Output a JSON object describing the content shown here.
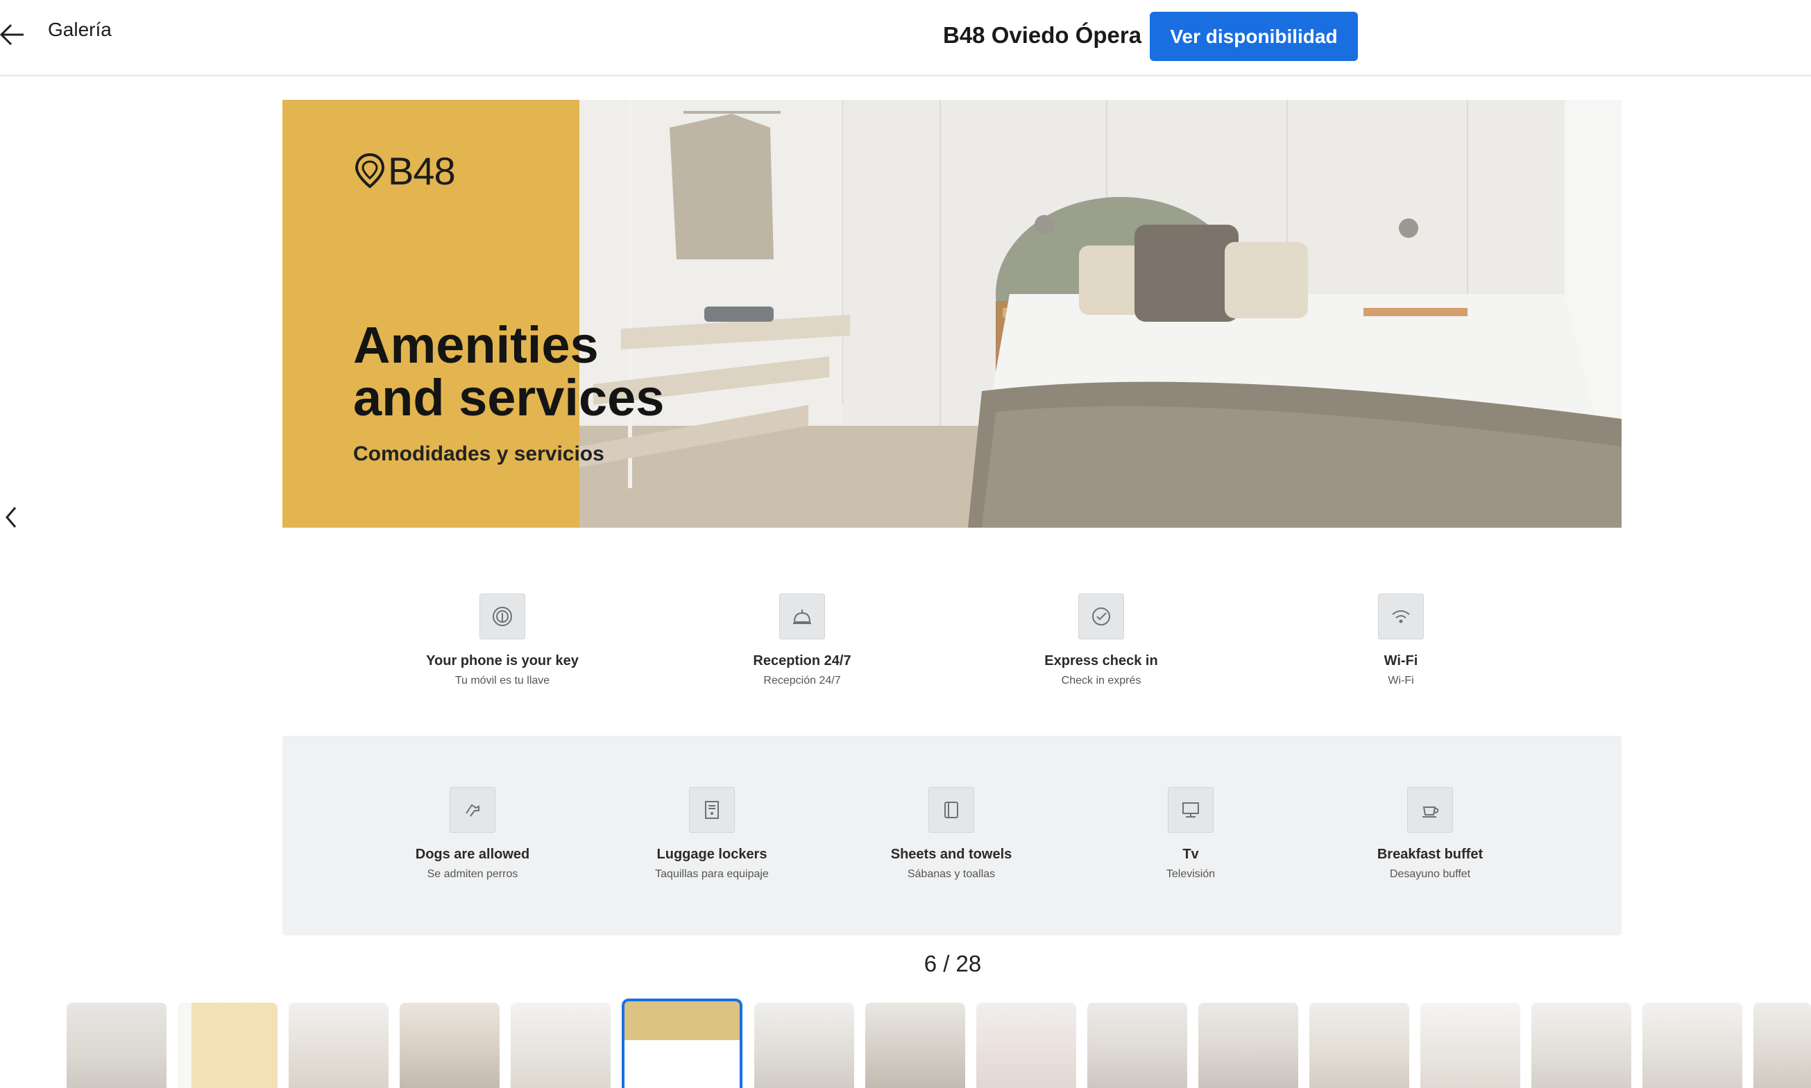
{
  "header": {
    "back_icon": "arrow-left-icon",
    "gallery_label": "Galería",
    "hotel_name": "B48 Oviedo Ópera",
    "availability_button": "Ver disponibilidad"
  },
  "navigation": {
    "prev_icon": "chevron-left-icon"
  },
  "slide": {
    "logo_text": "B48",
    "title_line1": "Amenities",
    "title_line2": "and services",
    "subtitle": "Comodidades y servicios",
    "amenities_top": [
      {
        "icon": "fingerprint-icon",
        "title": "Your phone is your key",
        "subtitle": "Tu móvil es tu llave"
      },
      {
        "icon": "reception-bell-icon",
        "title": "Reception 24/7",
        "subtitle": "Recepción 24/7"
      },
      {
        "icon": "check-circle-icon",
        "title": "Express check in",
        "subtitle": "Check in exprés"
      },
      {
        "icon": "wifi-icon",
        "title": "Wi-Fi",
        "subtitle": "Wi-Fi"
      }
    ],
    "amenities_bottom": [
      {
        "icon": "dog-icon",
        "title": "Dogs are allowed",
        "subtitle": "Se admiten perros"
      },
      {
        "icon": "locker-icon",
        "title": "Luggage lockers",
        "subtitle": "Taquillas para equipaje"
      },
      {
        "icon": "towel-icon",
        "title": "Sheets and towels",
        "subtitle": "Sábanas y toallas"
      },
      {
        "icon": "tv-icon",
        "title": "Tv",
        "subtitle": "Televisión"
      },
      {
        "icon": "coffee-cup-icon",
        "title": "Breakfast buffet",
        "subtitle": "Desayuno buffet"
      }
    ]
  },
  "counter": {
    "current": 6,
    "total": 28,
    "text": "6 / 28"
  },
  "thumbnails": {
    "active_index": 5,
    "count_visible": 16
  },
  "colors": {
    "accent": "#1a6fe0",
    "banner_yellow": "#e2b550",
    "band_gray": "#f0f1f2"
  }
}
